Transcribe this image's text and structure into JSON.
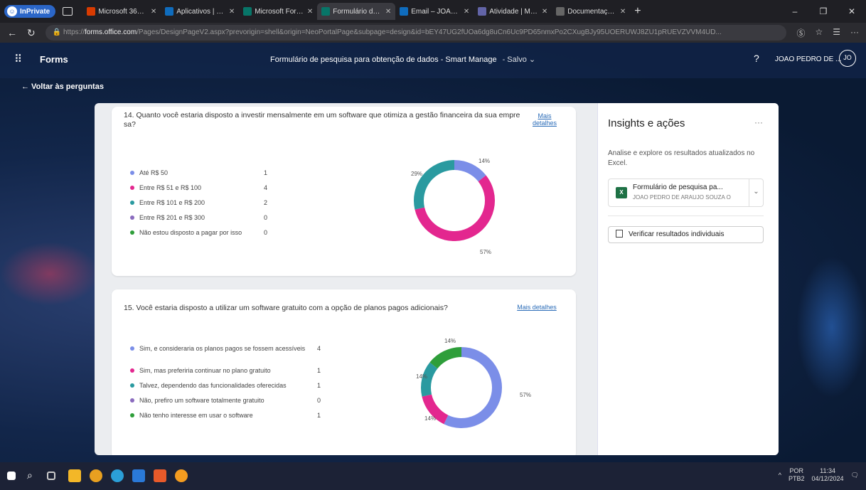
{
  "browser": {
    "private_label": "InPrivate",
    "tabs": [
      {
        "label": "Microsoft 365 - Pesq",
        "color": "#d83b01",
        "active": false
      },
      {
        "label": "Aplicativos | Microsof",
        "color": "#0f6cbd",
        "active": false
      },
      {
        "label": "Microsoft Forms",
        "color": "#077568",
        "active": false
      },
      {
        "label": "Formulário de pesqui",
        "color": "#077568",
        "active": true
      },
      {
        "label": "Email – JOAO PEDRO",
        "color": "#0f6cbd",
        "active": false
      },
      {
        "label": "Atividade | Microsoft",
        "color": "#6264a7",
        "active": false
      },
      {
        "label": "Documentação TCC.d",
        "color": "#666666",
        "active": false
      }
    ],
    "url_prefix": "https://",
    "url_domain": "forms.office.com",
    "url_path": "/Pages/DesignPageV2.aspx?prevorigin=shell&origin=NeoPortalPage&subpage=design&id=bEY47UG2fUOa6dg8uCn6Uc9PD65nmxPo2CXugBJy95UOERUWJ8ZU1pRUEVZVVM4UD..."
  },
  "header": {
    "app_name": "Forms",
    "form_title": "Formulário de pesquisa para obtenção de dados - Smart Manage",
    "saved_label": "-  Salvo  ⌄",
    "help": "?",
    "user_name": "JOAO PEDRO DE ...",
    "avatar_initials": "JO",
    "back_label": "← Voltar às perguntas"
  },
  "questions": [
    {
      "title": "14. Quanto você estaria disposto a investir mensalmente em um software que otimiza a gestão financeira da sua empre sa?",
      "more": "Mais detalhes",
      "options": [
        {
          "label": "Até R$ 50",
          "count": "1",
          "color": "#7b8ee8"
        },
        {
          "label": "Entre R$ 51 e R$ 100",
          "count": "4",
          "color": "#e3278f"
        },
        {
          "label": "Entre R$ 101 e R$ 200",
          "count": "2",
          "color": "#2a9aa0"
        },
        {
          "label": "Entre R$ 201 e R$ 300",
          "count": "0",
          "color": "#8a6bbe"
        },
        {
          "label": "Não estou disposto a pagar por isso",
          "count": "0",
          "color": "#2e9e3a"
        }
      ],
      "percents": {
        "p1": "14%",
        "p2": "57%",
        "p3": "29%"
      }
    },
    {
      "title": "15. Você estaria disposto a utilizar um software gratuito com a opção de planos pagos adicionais?",
      "more": "Mais detalhes",
      "options": [
        {
          "label": "Sim, e consideraria os planos pagos se fossem acessíveis",
          "count": "4",
          "color": "#7b8ee8"
        },
        {
          "label": "Sim, mas preferiria continuar no plano gratuito",
          "count": "1",
          "color": "#e3278f"
        },
        {
          "label": "Talvez, dependendo das funcionalidades oferecidas",
          "count": "1",
          "color": "#2a9aa0"
        },
        {
          "label": "Não, prefiro um software totalmente gratuito",
          "count": "0",
          "color": "#8a6bbe"
        },
        {
          "label": "Não tenho interesse em usar o software",
          "count": "1",
          "color": "#2e9e3a"
        }
      ],
      "percents": {
        "p1": "57%",
        "p2": "14%",
        "p3": "14%",
        "p4": "14%"
      }
    }
  ],
  "insights": {
    "title": "Insights e ações",
    "menu": "···",
    "description": "Analise e explore os resultados atualizados no Excel.",
    "excel_icon": "X",
    "excel_name": "Formulário de pesquisa pa...",
    "excel_owner": "JOAO PEDRO DE ARAUJO SOUZA O",
    "view_button": "Verificar resultados individuais"
  },
  "taskbar": {
    "lang_top": "POR",
    "lang_bottom": "PTB2",
    "time": "11:34",
    "date": "04/12/2024"
  }
}
